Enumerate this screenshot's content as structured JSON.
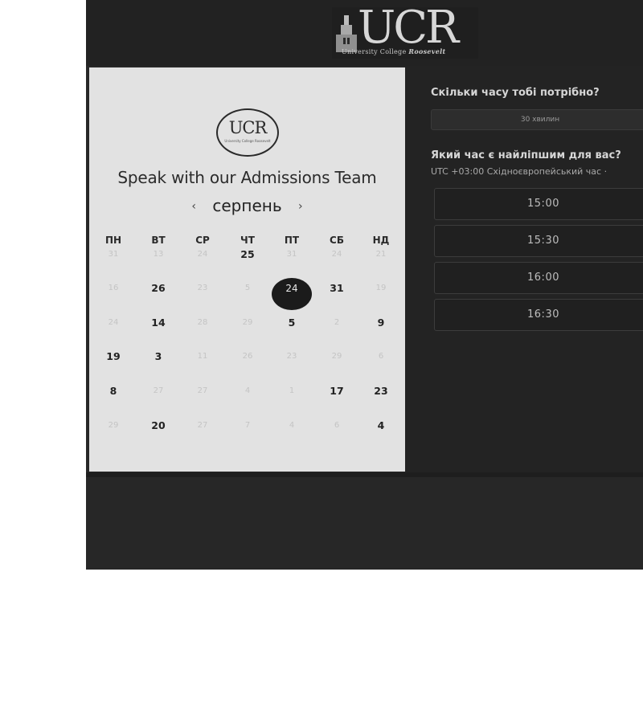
{
  "header": {
    "logo_text": "UCR",
    "logo_subtitle_a": "University College ",
    "logo_subtitle_b": "Roosevelt"
  },
  "calendar": {
    "round_logo_text": "UCR",
    "round_logo_subtitle": "University College Roosevelt",
    "title": "Speak with our Admissions Team",
    "month": "серпень",
    "prev_icon": "‹",
    "next_icon": "›",
    "weekdays": [
      "ПН",
      "ВТ",
      "СР",
      "ЧТ",
      "ПТ",
      "СБ",
      "НД"
    ],
    "weeks": [
      [
        {
          "label": "31",
          "active": false
        },
        {
          "label": "13",
          "active": false
        },
        {
          "label": "24",
          "active": false
        },
        {
          "label": "25",
          "active": true
        },
        {
          "label": "31",
          "active": false
        },
        {
          "label": "24",
          "active": false
        },
        {
          "label": "21",
          "active": false
        }
      ],
      [
        {
          "label": "16",
          "active": false
        },
        {
          "label": "26",
          "active": true
        },
        {
          "label": "23",
          "active": false
        },
        {
          "label": "5",
          "active": false
        },
        {
          "label": "24",
          "active": true,
          "selected": true
        },
        {
          "label": "31",
          "active": true
        },
        {
          "label": "19",
          "active": false
        }
      ],
      [
        {
          "label": "24",
          "active": false
        },
        {
          "label": "14",
          "active": true
        },
        {
          "label": "28",
          "active": false
        },
        {
          "label": "29",
          "active": false
        },
        {
          "label": "5",
          "active": true
        },
        {
          "label": "2",
          "active": false
        },
        {
          "label": "9",
          "active": true
        }
      ],
      [
        {
          "label": "19",
          "active": true
        },
        {
          "label": "3",
          "active": true
        },
        {
          "label": "11",
          "active": false
        },
        {
          "label": "26",
          "active": false
        },
        {
          "label": "23",
          "active": false
        },
        {
          "label": "29",
          "active": false
        },
        {
          "label": "6",
          "active": false
        }
      ],
      [
        {
          "label": "8",
          "active": true
        },
        {
          "label": "27",
          "active": false
        },
        {
          "label": "27",
          "active": false
        },
        {
          "label": "4",
          "active": false
        },
        {
          "label": "1",
          "active": false
        },
        {
          "label": "17",
          "active": true
        },
        {
          "label": "23",
          "active": true
        }
      ],
      [
        {
          "label": "29",
          "active": false
        },
        {
          "label": "20",
          "active": true
        },
        {
          "label": "27",
          "active": false
        },
        {
          "label": "7",
          "active": false
        },
        {
          "label": "4",
          "active": false
        },
        {
          "label": "6",
          "active": false
        },
        {
          "label": "4",
          "active": true
        }
      ]
    ]
  },
  "booking": {
    "duration_label": "Скільки часу тобі потрібно?",
    "duration_value": "30 хвилин",
    "time_question": "Який час є найліпшим для вас?",
    "timezone": "UTC +03:00 Східноєвропейський час ·",
    "slots": [
      "15:00",
      "15:30",
      "16:00",
      "16:30"
    ]
  }
}
